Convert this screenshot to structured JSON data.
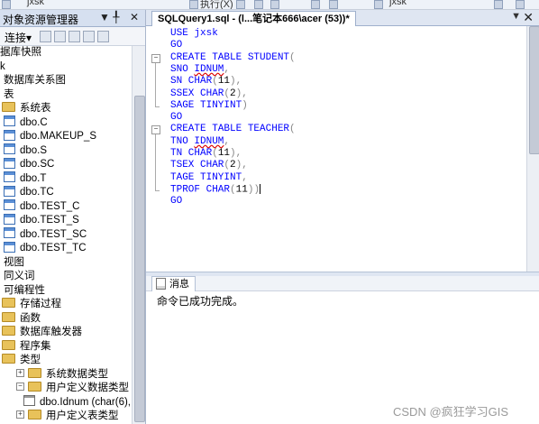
{
  "toolbar": {
    "db_name": "jxsk",
    "execute_label": "执行(X)",
    "db_name_right": "jxsk"
  },
  "explorer": {
    "title": "对象资源管理器",
    "pin_symbol": "▼ ╀",
    "close_symbol": "✕",
    "connect_label": "连接▾",
    "tree": [
      {
        "label": "据库快照",
        "icon": "none",
        "kind": "text"
      },
      {
        "label": "k",
        "icon": "none",
        "kind": "text"
      },
      {
        "label": "数据库关系图",
        "icon": "none",
        "kind": "text"
      },
      {
        "label": "表",
        "icon": "none",
        "kind": "text"
      },
      {
        "label": "系统表",
        "icon": "folder-icon",
        "kind": "folder"
      },
      {
        "label": "dbo.C",
        "icon": "table-icon",
        "kind": "table"
      },
      {
        "label": "dbo.MAKEUP_S",
        "icon": "table-icon",
        "kind": "table"
      },
      {
        "label": "dbo.S",
        "icon": "table-icon",
        "kind": "table"
      },
      {
        "label": "dbo.SC",
        "icon": "table-icon",
        "kind": "table"
      },
      {
        "label": "dbo.T",
        "icon": "table-icon",
        "kind": "table"
      },
      {
        "label": "dbo.TC",
        "icon": "table-icon",
        "kind": "table"
      },
      {
        "label": "dbo.TEST_C",
        "icon": "table-icon",
        "kind": "table"
      },
      {
        "label": "dbo.TEST_S",
        "icon": "table-icon",
        "kind": "table"
      },
      {
        "label": "dbo.TEST_SC",
        "icon": "table-icon",
        "kind": "table"
      },
      {
        "label": "dbo.TEST_TC",
        "icon": "table-icon",
        "kind": "table"
      },
      {
        "label": "视图",
        "icon": "none",
        "kind": "text"
      },
      {
        "label": "同义词",
        "icon": "none",
        "kind": "text"
      },
      {
        "label": "可编程性",
        "icon": "none",
        "kind": "text"
      },
      {
        "label": "存储过程",
        "icon": "folder-icon",
        "kind": "folder"
      },
      {
        "label": "函数",
        "icon": "folder-icon",
        "kind": "folder"
      },
      {
        "label": "数据库触发器",
        "icon": "folder-icon",
        "kind": "folder"
      },
      {
        "label": "程序集",
        "icon": "folder-icon",
        "kind": "folder"
      },
      {
        "label": "类型",
        "icon": "folder-icon",
        "kind": "folder"
      },
      {
        "label": "系统数据类型",
        "icon": "folder-icon",
        "kind": "folder"
      },
      {
        "label": "用户定义数据类型",
        "icon": "folder-icon",
        "kind": "folder"
      },
      {
        "label": "dbo.Idnum (char(6),",
        "icon": "type-icon",
        "kind": "type"
      },
      {
        "label": "用户定义表类型",
        "icon": "folder-icon",
        "kind": "folder"
      }
    ]
  },
  "editor": {
    "tab_title": "SQLQuery1.sql - (l...笔记本666\\acer (53))*",
    "tab_controls": "▼ ✕",
    "code": [
      "USE jxsk",
      "GO",
      "CREATE TABLE STUDENT(",
      "SNO IDNUM,",
      "SN CHAR(11),",
      "SSEX CHAR(2),",
      "SAGE TINYINT)",
      "GO",
      "CREATE TABLE TEACHER(",
      "TNO IDNUM,",
      "TN CHAR(11),",
      "TSEX CHAR(2),",
      "TAGE TINYINT,",
      "TPROF CHAR(11))",
      "GO"
    ]
  },
  "messages": {
    "tab_label": "消息",
    "text": "命令已成功完成。"
  },
  "watermark": "CSDN @疯狂学习GIS"
}
